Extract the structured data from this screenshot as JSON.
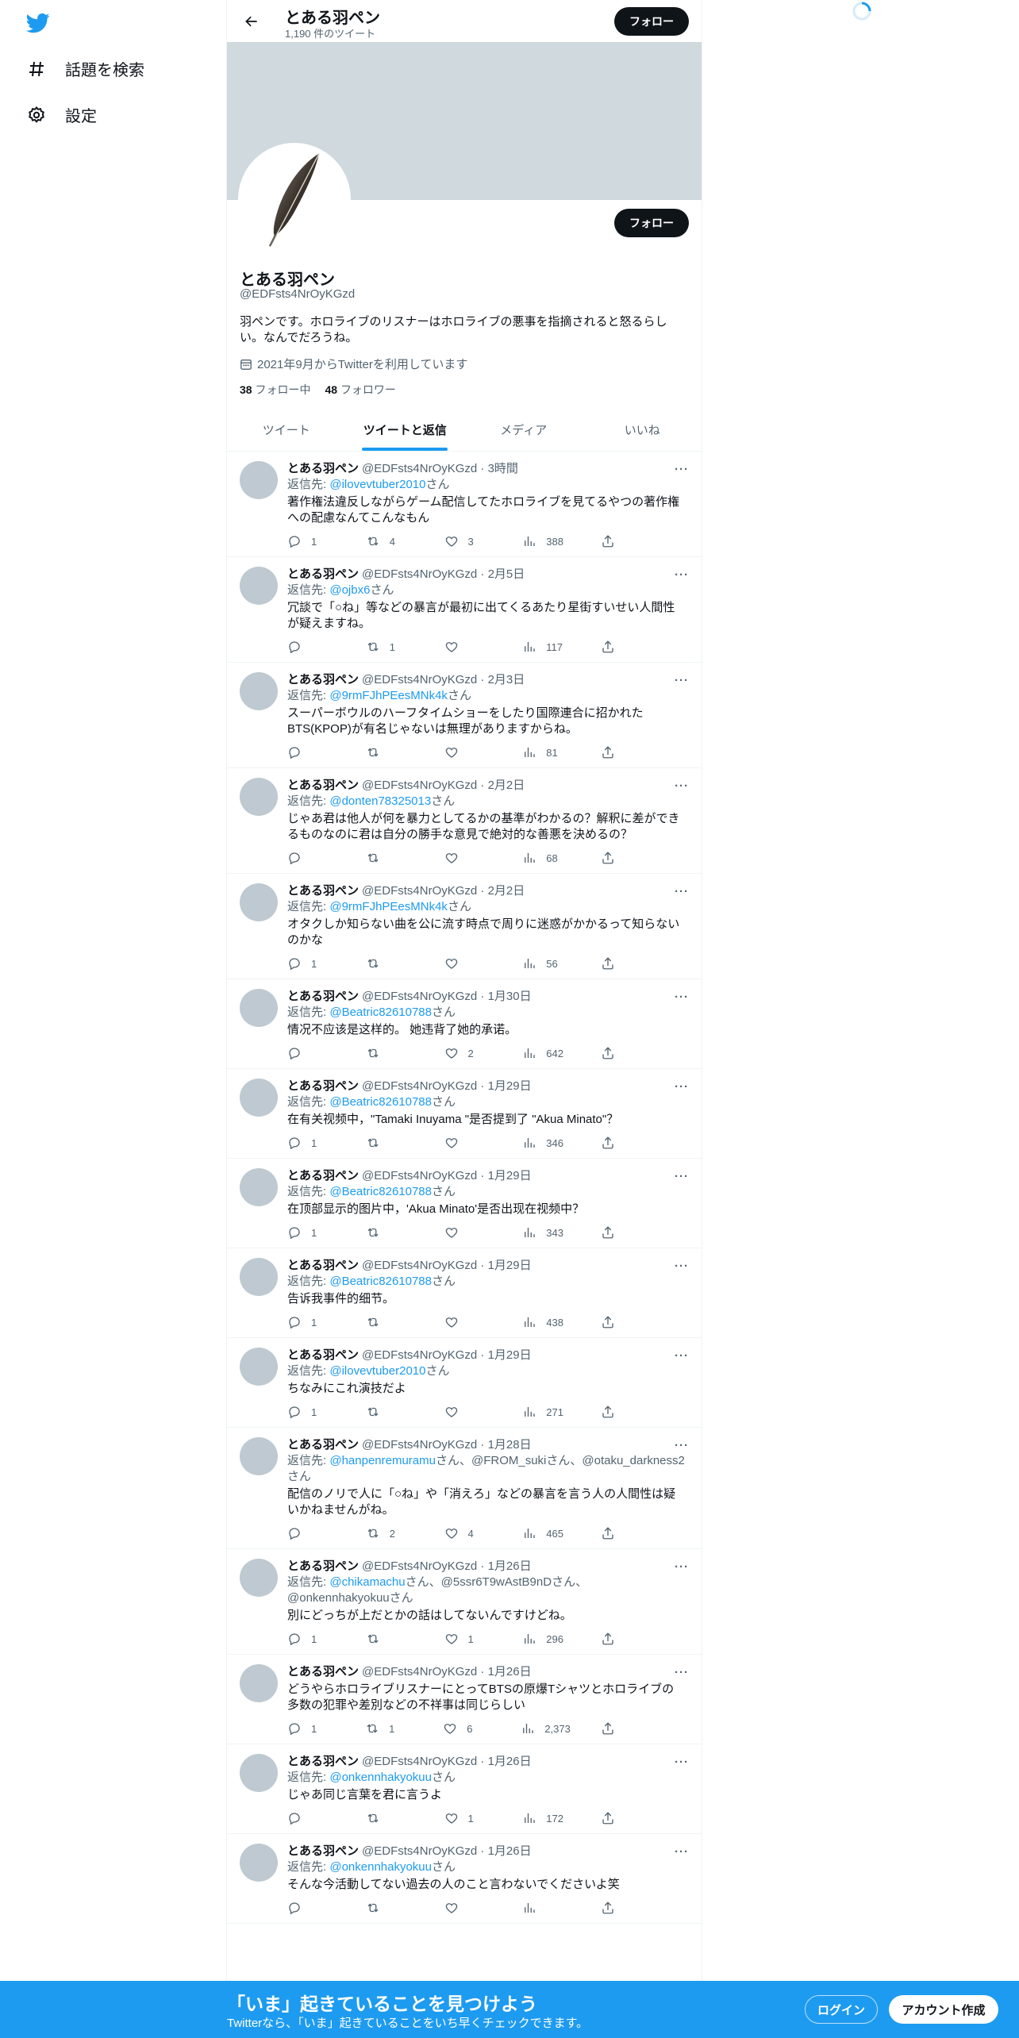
{
  "nav": {
    "explore_label": "話題を検索",
    "settings_label": "設定"
  },
  "topbar": {
    "name": "とある羽ペン",
    "tweet_count": "1,190 件のツイート",
    "follow_label": "フォロー"
  },
  "profile": {
    "name": "とある羽ペン",
    "handle": "@EDFsts4NrOyKGzd",
    "bio": "羽ペンです。ホロライブのリスナーはホロライブの悪事を指摘されると怒るらしい。なんでだろうね。",
    "joined": "2021年9月からTwitterを利用しています",
    "following_count": "38",
    "following_label": "フォロー中",
    "followers_count": "48",
    "followers_label": "フォロワー",
    "follow_label": "フォロー"
  },
  "tabs": [
    {
      "label": "ツイート"
    },
    {
      "label": "ツイートと返信"
    },
    {
      "label": "メディア"
    },
    {
      "label": "いいね"
    }
  ],
  "tweets": [
    {
      "name": "とある羽ペン",
      "meta": "@EDFsts4NrOyKGzd · 3時間",
      "reply_prefix": "返信先: ",
      "reply_to": "@ilovevtuber2010",
      "reply_suffix": "さん",
      "text": "著作権法違反しながらゲーム配信してたホロライブを見てるやつの著作権への配慮なんてこんなもん",
      "replies": "1",
      "retweets": "4",
      "likes": "3",
      "views": "388"
    },
    {
      "name": "とある羽ペン",
      "meta": "@EDFsts4NrOyKGzd · 2月5日",
      "reply_prefix": "返信先: ",
      "reply_to": "@ojbx6",
      "reply_suffix": "さん",
      "text": "冗談で「○ね」等などの暴言が最初に出てくるあたり星街すいせい人間性が疑えますね。",
      "replies": "",
      "retweets": "1",
      "likes": "",
      "views": "117"
    },
    {
      "name": "とある羽ペン",
      "meta": "@EDFsts4NrOyKGzd · 2月3日",
      "reply_prefix": "返信先: ",
      "reply_to": "@9rmFJhPEesMNk4k",
      "reply_suffix": "さん",
      "text": "スーパーボウルのハーフタイムショーをしたり国際連合に招かれたBTS(KPOP)が有名じゃないは無理がありますからね。",
      "replies": "",
      "retweets": "",
      "likes": "",
      "views": "81"
    },
    {
      "name": "とある羽ペン",
      "meta": "@EDFsts4NrOyKGzd · 2月2日",
      "reply_prefix": "返信先: ",
      "reply_to": "@donten78325013",
      "reply_suffix": "さん",
      "text": "じゃあ君は他人が何を暴力としてるかの基準がわかるの？解釈に差ができるものなのに君は自分の勝手な意見で絶対的な善悪を決めるの？",
      "replies": "",
      "retweets": "",
      "likes": "",
      "views": "68"
    },
    {
      "name": "とある羽ペン",
      "meta": "@EDFsts4NrOyKGzd · 2月2日",
      "reply_prefix": "返信先: ",
      "reply_to": "@9rmFJhPEesMNk4k",
      "reply_suffix": "さん",
      "text": "オタクしか知らない曲を公に流す時点で周りに迷惑がかかるって知らないのかな",
      "replies": "1",
      "retweets": "",
      "likes": "",
      "views": "56"
    },
    {
      "name": "とある羽ペン",
      "meta": "@EDFsts4NrOyKGzd · 1月30日",
      "reply_prefix": "返信先: ",
      "reply_to": "@Beatric82610788",
      "reply_suffix": "さん",
      "text": "情况不应该是这样的。 她违背了她的承诺。",
      "replies": "",
      "retweets": "",
      "likes": "2",
      "views": "642"
    },
    {
      "name": "とある羽ペン",
      "meta": "@EDFsts4NrOyKGzd · 1月29日",
      "reply_prefix": "返信先: ",
      "reply_to": "@Beatric82610788",
      "reply_suffix": "さん",
      "text": "在有关视频中，\"Tamaki Inuyama \"是否提到了 \"Akua Minato\"？",
      "replies": "1",
      "retweets": "",
      "likes": "",
      "views": "346"
    },
    {
      "name": "とある羽ペン",
      "meta": "@EDFsts4NrOyKGzd · 1月29日",
      "reply_prefix": "返信先: ",
      "reply_to": "@Beatric82610788",
      "reply_suffix": "さん",
      "text": "在顶部显示的图片中，'Akua Minato'是否出现在视频中？",
      "replies": "1",
      "retweets": "",
      "likes": "",
      "views": "343"
    },
    {
      "name": "とある羽ペン",
      "meta": "@EDFsts4NrOyKGzd · 1月29日",
      "reply_prefix": "返信先: ",
      "reply_to": "@Beatric82610788",
      "reply_suffix": "さん",
      "text": "告诉我事件的细节。",
      "replies": "1",
      "retweets": "",
      "likes": "",
      "views": "438"
    },
    {
      "name": "とある羽ペン",
      "meta": "@EDFsts4NrOyKGzd · 1月29日",
      "reply_prefix": "返信先: ",
      "reply_to": "@ilovevtuber2010",
      "reply_suffix": "さん",
      "text": "ちなみにこれ演技だよ",
      "replies": "1",
      "retweets": "",
      "likes": "",
      "views": "271"
    },
    {
      "name": "とある羽ペン",
      "meta": "@EDFsts4NrOyKGzd · 1月28日",
      "reply_prefix": "返信先: ",
      "reply_to": "@hanpenremuramu",
      "reply_suffix": "さん、@FROM_sukiさん、@otaku_darkness2さん",
      "text": "配信のノリで人に「○ね」や「消えろ」などの暴言を言う人の人間性は疑いかねませんがね。",
      "replies": "",
      "retweets": "2",
      "likes": "4",
      "views": "465"
    },
    {
      "name": "とある羽ペン",
      "meta": "@EDFsts4NrOyKGzd · 1月26日",
      "reply_prefix": "返信先: ",
      "reply_to": "@chikamachu",
      "reply_suffix": "さん、@5ssr6T9wAstB9nDさん、@onkennhakyokuuさん",
      "text": "別にどっちが上だとかの話はしてないんですけどね。",
      "replies": "1",
      "retweets": "",
      "likes": "1",
      "views": "296"
    },
    {
      "name": "とある羽ペン",
      "meta": "@EDFsts4NrOyKGzd · 1月26日",
      "reply_prefix": "",
      "reply_to": "",
      "reply_suffix": "",
      "text": "どうやらホロライブリスナーにとってBTSの原爆Tシャツとホロライブの多数の犯罪や差別などの不祥事は同じらしい",
      "replies": "1",
      "retweets": "1",
      "likes": "6",
      "views": "2,373"
    },
    {
      "name": "とある羽ペン",
      "meta": "@EDFsts4NrOyKGzd · 1月26日",
      "reply_prefix": "返信先: ",
      "reply_to": "@onkennhakyokuu",
      "reply_suffix": "さん",
      "text": "じゃあ同じ言葉を君に言うよ",
      "replies": "",
      "retweets": "",
      "likes": "1",
      "views": "172"
    },
    {
      "name": "とある羽ペン",
      "meta": "@EDFsts4NrOyKGzd · 1月26日",
      "reply_prefix": "返信先: ",
      "reply_to": "@onkennhakyokuu",
      "reply_suffix": "さん",
      "text": "そんな今活動してない過去の人のこと言わないでくださいよ笑",
      "replies": "",
      "retweets": "",
      "likes": "",
      "views": ""
    }
  ],
  "bottombar": {
    "title": "「いま」起きていることを見つけよう",
    "subtitle": "Twitterなら、「いま」起きていることをいち早くチェックできます。",
    "login_label": "ログイン",
    "signup_label": "アカウント作成"
  },
  "colors": {
    "accent": "#1d9bf0",
    "text": "#0f1419",
    "muted": "#536471",
    "banner": "#cfd9de"
  }
}
